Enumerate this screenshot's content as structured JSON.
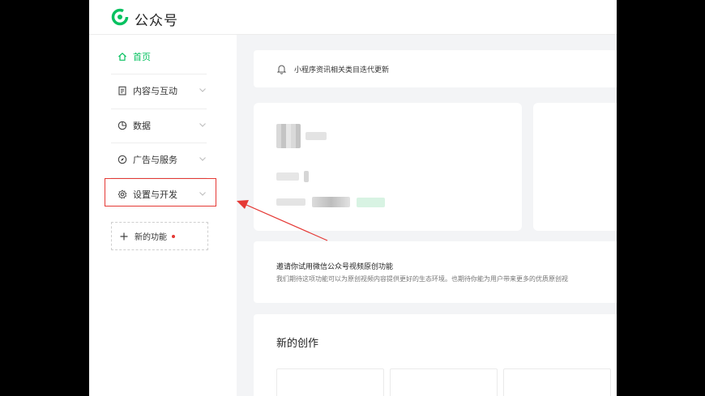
{
  "app": {
    "title": "公众号",
    "brand_color": "#07c160"
  },
  "sidebar": {
    "items": [
      {
        "label": "首页",
        "icon": "home-icon",
        "active": true
      },
      {
        "label": "内容与互动",
        "icon": "document-icon"
      },
      {
        "label": "数据",
        "icon": "pie-chart-icon"
      },
      {
        "label": "广告与服务",
        "icon": "compass-icon"
      },
      {
        "label": "设置与开发",
        "icon": "gear-icon"
      }
    ],
    "new_feature_label": "新的功能"
  },
  "notice": {
    "text": "小程序资讯相关类目迭代更新",
    "icon": "bell-icon"
  },
  "original_invite": {
    "title": "邀请你试用微信公众号视频原创功能",
    "description": "我们期待这项功能可以为原创视频内容提供更好的生态环境。也期待你能为用户带来更多的优质原创视"
  },
  "creation": {
    "title": "新的创作"
  },
  "annotation": {
    "highlight_color": "#e53935"
  }
}
